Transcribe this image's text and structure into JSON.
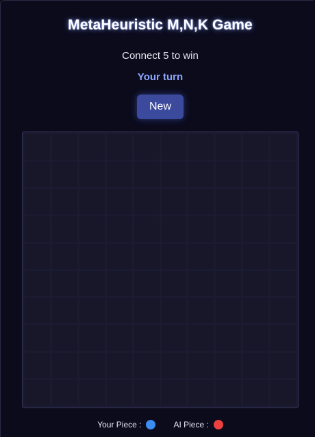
{
  "game": {
    "title": "MetaHeuristic M,N,K Game",
    "subtitle": "Connect 5 to win",
    "status": "Your turn",
    "new_button_label": "New"
  },
  "board": {
    "rows": 10,
    "cols": 10,
    "cells": [
      [
        "",
        "",
        "",
        "",
        "",
        "",
        "",
        "",
        "",
        ""
      ],
      [
        "",
        "",
        "",
        "",
        "",
        "",
        "",
        "",
        "",
        ""
      ],
      [
        "",
        "",
        "",
        "",
        "",
        "",
        "",
        "",
        "",
        ""
      ],
      [
        "",
        "",
        "",
        "",
        "",
        "",
        "",
        "",
        "",
        ""
      ],
      [
        "",
        "",
        "",
        "",
        "",
        "",
        "",
        "",
        "",
        ""
      ],
      [
        "",
        "",
        "",
        "",
        "",
        "",
        "",
        "",
        "",
        ""
      ],
      [
        "",
        "",
        "",
        "",
        "",
        "",
        "",
        "",
        "",
        ""
      ],
      [
        "",
        "",
        "",
        "",
        "",
        "",
        "",
        "",
        "",
        ""
      ],
      [
        "",
        "",
        "",
        "",
        "",
        "",
        "",
        "",
        "",
        ""
      ],
      [
        "",
        "",
        "",
        "",
        "",
        "",
        "",
        "",
        "",
        ""
      ]
    ]
  },
  "legend": {
    "player_label": "Your Piece :",
    "player_color": "#3b8df0",
    "ai_label": "AI Piece :",
    "ai_color": "#ec4040"
  },
  "colors": {
    "background": "#0b0b18",
    "accent": "#8ea8ff",
    "button": "#3b4a9c"
  }
}
